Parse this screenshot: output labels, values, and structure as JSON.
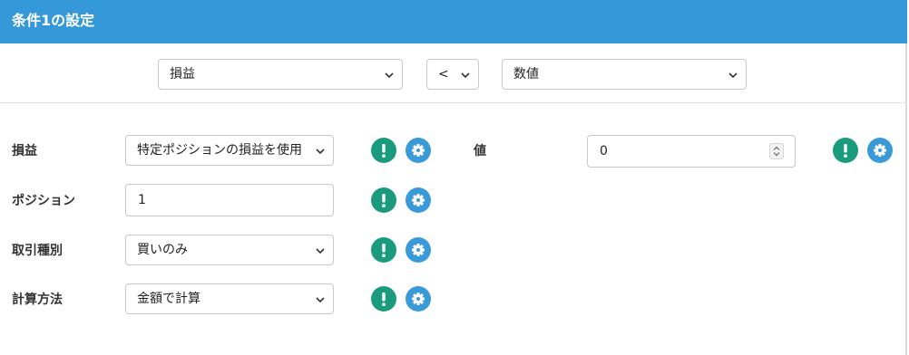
{
  "header": {
    "title": "条件1の設定"
  },
  "condition": {
    "left_select": "損益",
    "operator_select": "<",
    "right_select": "数値"
  },
  "fields": {
    "profit": {
      "label": "損益",
      "value": "特定ポジションの損益を使用"
    },
    "position": {
      "label": "ポジション",
      "value": "1"
    },
    "trade_type": {
      "label": "取引種別",
      "value": "買いのみ"
    },
    "calc_method": {
      "label": "計算方法",
      "value": "金額で計算"
    },
    "value": {
      "label": "値",
      "value": "0"
    }
  },
  "icons": {
    "warning": "exclamation-icon",
    "settings": "gear-icon",
    "chevron": "chevron-down-icon"
  },
  "colors": {
    "header_bg": "#3599d9",
    "warning_green": "#1a9b7d",
    "settings_blue": "#3a9ad9"
  }
}
